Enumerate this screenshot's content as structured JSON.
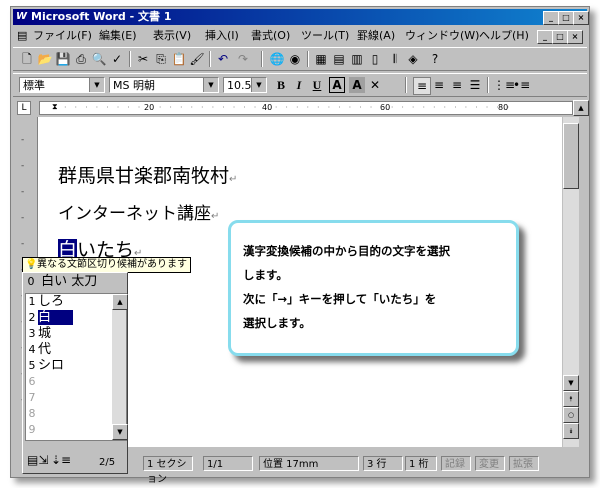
{
  "window": {
    "title": "Microsoft Word - 文書 1"
  },
  "menu": [
    "ファイル(F)",
    "編集(E)",
    "表示(V)",
    "挿入(I)",
    "書式(O)",
    "ツール(T)",
    "罫線(A)",
    "ウィンドウ(W)",
    "ヘルプ(H)"
  ],
  "toolbar": {
    "style": "標準",
    "font": "MS 明朝",
    "size": "10.5",
    "bold": "B",
    "italic": "I",
    "underline": "U"
  },
  "ruler": {
    "marks": [
      "20",
      "40",
      "60",
      "80"
    ]
  },
  "document": {
    "line1": "群馬県甘楽郡南牧村",
    "line2": "インターネット講座",
    "line3_selected": "白",
    "line3_rest": "いたち",
    "pilcrow": "↵"
  },
  "ime": {
    "tooltip": "異なる文節区切り候補があります",
    "header_num": "0",
    "header_text": "白い 太刀",
    "candidates": [
      {
        "num": "1",
        "text": "しろ"
      },
      {
        "num": "2",
        "text": "白"
      },
      {
        "num": "3",
        "text": "城"
      },
      {
        "num": "4",
        "text": "代"
      },
      {
        "num": "5",
        "text": "シロ"
      },
      {
        "num": "6",
        "text": ""
      },
      {
        "num": "7",
        "text": ""
      },
      {
        "num": "8",
        "text": ""
      },
      {
        "num": "9",
        "text": ""
      }
    ],
    "page": "2/5"
  },
  "callout": {
    "line1": "漢字変換候補の中から目的の文字を選択",
    "line2": "します。",
    "line3": "次に「→」キーを押して「いたち」を",
    "line4": "選択します。"
  },
  "status": {
    "section": "1 セクション",
    "page": "1/1",
    "position": "位置 17mm",
    "line": "3 行",
    "col": "1 桁",
    "rec": "記録",
    "trk": "変更",
    "ext": "拡張"
  }
}
